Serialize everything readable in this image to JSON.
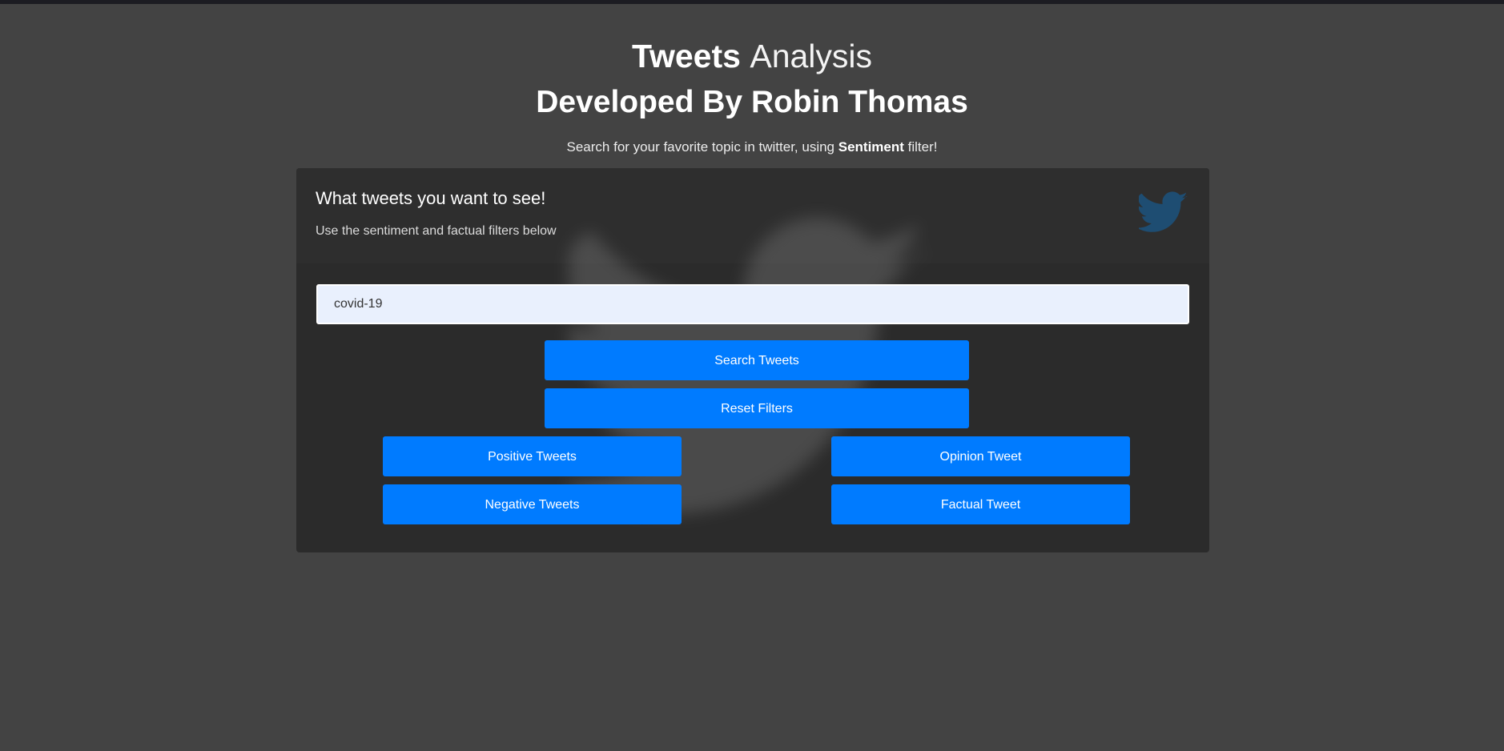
{
  "header": {
    "title_bold": "Tweets",
    "title_light": "Analysis",
    "subtitle": "Developed By Robin Thomas",
    "tagline_prefix": "Search for your favorite topic in twitter, using ",
    "tagline_bold": "Sentiment",
    "tagline_suffix": " filter!"
  },
  "card": {
    "title": "What tweets you want to see!",
    "description": "Use the sentiment and factual filters below",
    "icon": "twitter-bird-icon",
    "background_icon": "twitter-bird-icon"
  },
  "search": {
    "value": "covid-19"
  },
  "buttons": {
    "search": "Search Tweets",
    "reset": "Reset Filters",
    "positive": "Positive Tweets",
    "negative": "Negative Tweets",
    "opinion": "Opinion Tweet",
    "factual": "Factual Tweet"
  },
  "colors": {
    "background": "#434343",
    "card": "#2b2b2b",
    "button": "#007bff",
    "input": "#e9f0fd",
    "twitter_icon": "#1e4d72"
  }
}
